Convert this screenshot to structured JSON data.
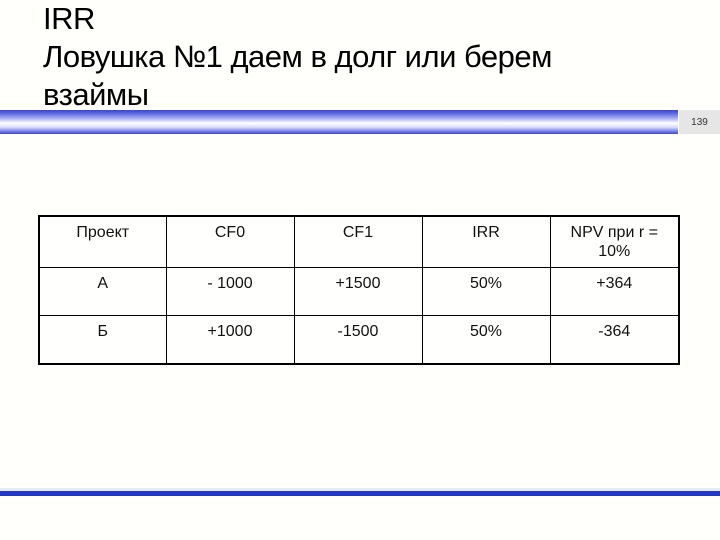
{
  "slide": {
    "title_lines": [
      "IRR",
      "Ловушка №1 даем в долг или берем",
      "взаймы"
    ],
    "page_number": "139"
  },
  "table": {
    "headers": [
      "Проект",
      "CF0",
      "CF1",
      "IRR",
      "NPV при r = 10%"
    ],
    "rows": [
      [
        "А",
        "- 1000",
        "+1500",
        "50%",
        "+364"
      ],
      [
        "Б",
        "+1000",
        "-1500",
        "50%",
        "-364"
      ]
    ]
  },
  "colors": {
    "band_accent": "#2238c8",
    "background": "#fffffb"
  }
}
